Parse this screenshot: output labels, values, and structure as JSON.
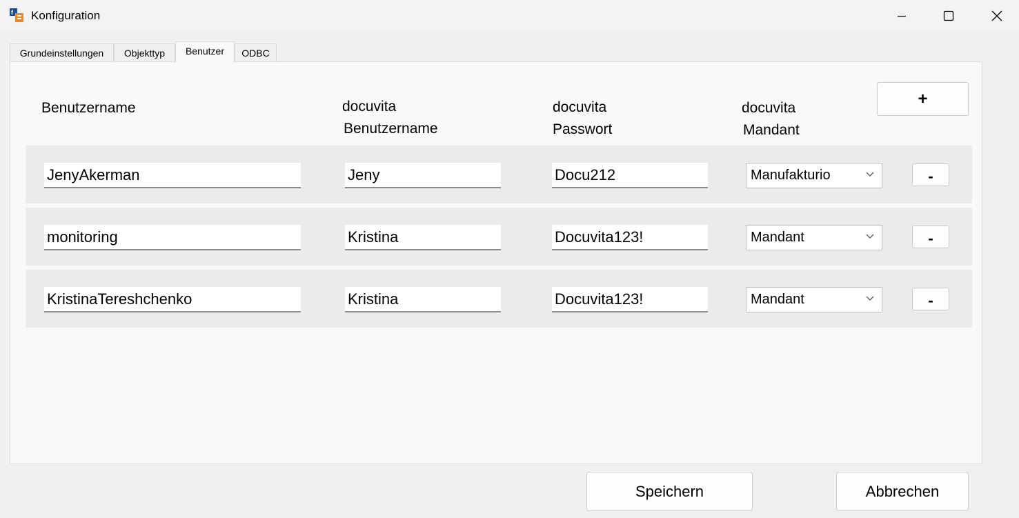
{
  "window": {
    "title": "Konfiguration",
    "icons": {
      "app": "app-icon",
      "minimize": "minimize-icon",
      "maximize": "maximize-icon",
      "close": "close-icon"
    }
  },
  "tabs": [
    {
      "label": "Grundeinstellungen",
      "active": false
    },
    {
      "label": "Objekttyp",
      "active": false
    },
    {
      "label": "Benutzer",
      "active": true
    },
    {
      "label": "ODBC",
      "active": false
    }
  ],
  "columns": {
    "username": "Benutzername",
    "docuvita_username": [
      "docuvita",
      "Benutzername"
    ],
    "docuvita_password": [
      "docuvita",
      "Passwort"
    ],
    "docuvita_mandant": [
      "docuvita",
      "Mandant"
    ]
  },
  "add_label": "+",
  "remove_label": "-",
  "rows": [
    {
      "username": "JenyAkerman",
      "docuvita_username": "Jeny",
      "docuvita_password": "Docu212",
      "mandant": "Manufakturio"
    },
    {
      "username": "monitoring",
      "docuvita_username": "Kristina",
      "docuvita_password": "Docuvita123!",
      "mandant": "Mandant"
    },
    {
      "username": "KristinaTereshchenko",
      "docuvita_username": "Kristina",
      "docuvita_password": "Docuvita123!",
      "mandant": "Mandant"
    }
  ],
  "buttons": {
    "save": "Speichern",
    "cancel": "Abbrechen"
  },
  "colors": {
    "panel": "#f9f9f9",
    "row": "#ebebeb",
    "window": "#f0f0f0"
  }
}
